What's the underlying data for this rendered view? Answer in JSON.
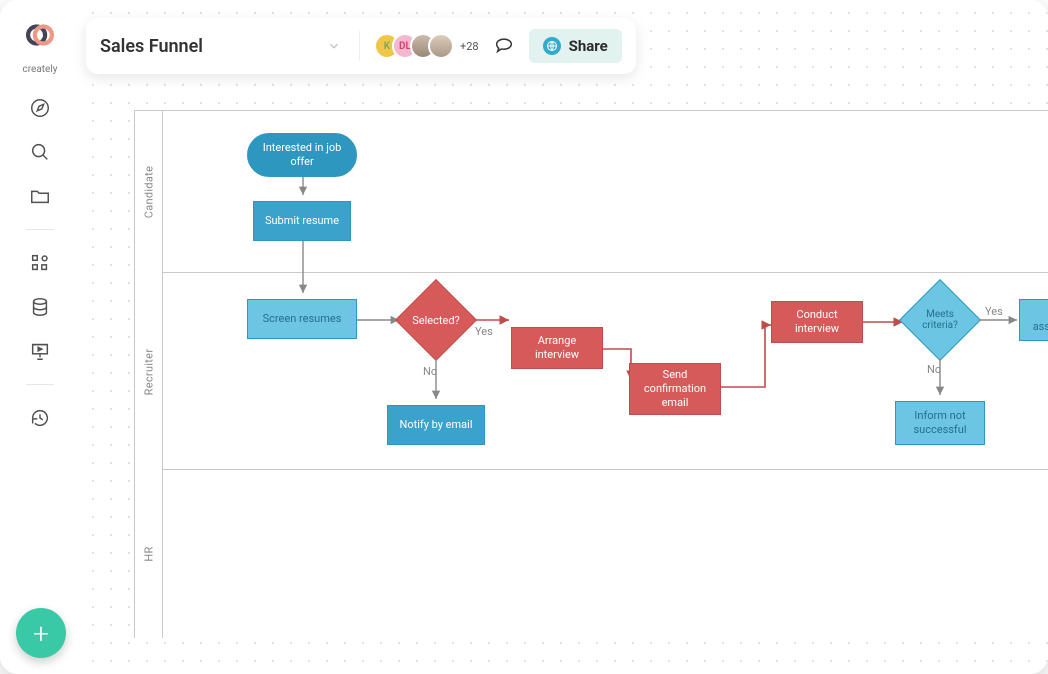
{
  "brand": {
    "name": "creately"
  },
  "header": {
    "title": "Sales Funnel",
    "share_label": "Share",
    "avatar1": "K",
    "avatar2": "DL",
    "more_count": "+28"
  },
  "swimlanes": {
    "lane1": "Candidate",
    "lane2": "Recruiter",
    "lane3": "HR"
  },
  "nodes": {
    "interested": "Interested in job offer",
    "submit": "Submit resume",
    "screen": "Screen resumes",
    "selected": "Selected?",
    "notify": "Notify by email",
    "arrange_int": "Arrange interview",
    "send_conf": "Send confirmation email",
    "conduct": "Conduct interview",
    "meets": "Meets criteria?",
    "inform": "Inform not successful",
    "arrange_assess": "Arrange assessment d"
  },
  "edge_labels": {
    "yes1": "Yes",
    "no1": "No",
    "yes2": "Yes",
    "no2": "No"
  },
  "colors": {
    "blue_fill": "#3aa2cb",
    "lightblue_fill": "#6cc5e2",
    "blue_stroke": "#2d97bf",
    "red_fill": "#d65a5a",
    "red_stroke": "#c24a4a",
    "grey_stroke": "#888888"
  }
}
